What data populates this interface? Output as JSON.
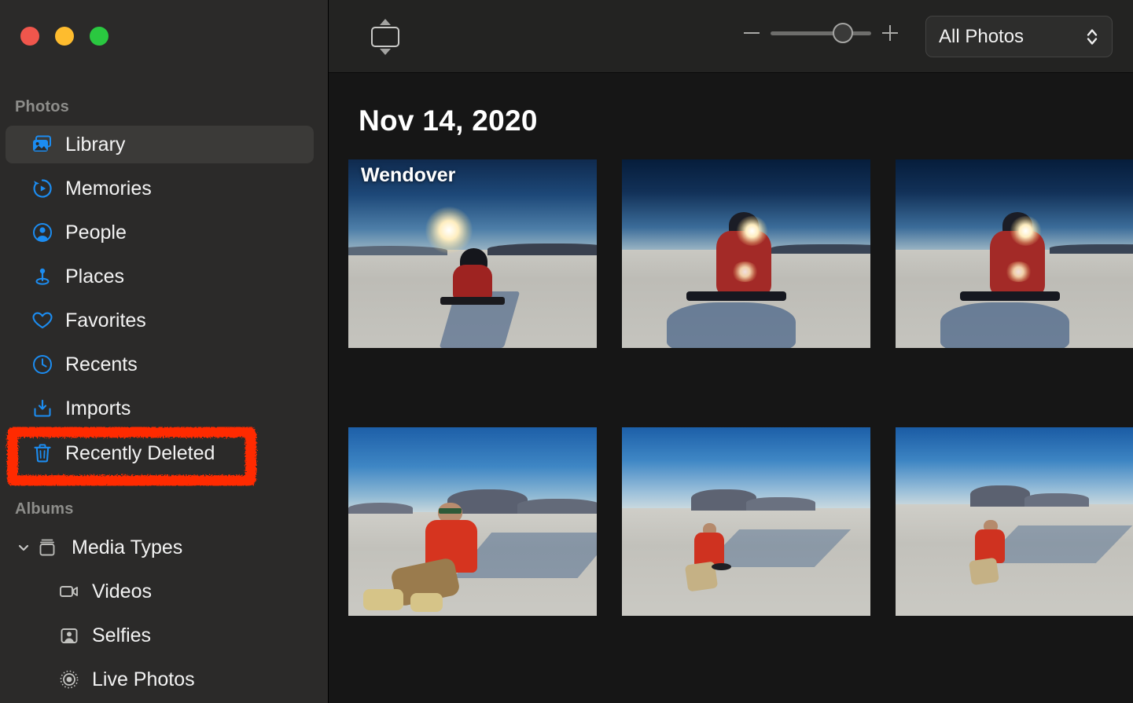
{
  "window": {
    "traffic_lights": [
      {
        "name": "close",
        "color": "#f0564c"
      },
      {
        "name": "minimize",
        "color": "#febc2e"
      },
      {
        "name": "maximize",
        "color": "#2ac840"
      }
    ]
  },
  "sidebar": {
    "sections": [
      {
        "header": "Photos",
        "items": [
          {
            "label": "Library",
            "icon": "photo-stack-icon",
            "selected": true,
            "highlighted": false
          },
          {
            "label": "Memories",
            "icon": "memories-icon",
            "selected": false,
            "highlighted": false
          },
          {
            "label": "People",
            "icon": "person-circle-icon",
            "selected": false,
            "highlighted": false
          },
          {
            "label": "Places",
            "icon": "map-pin-icon",
            "selected": false,
            "highlighted": false
          },
          {
            "label": "Favorites",
            "icon": "heart-icon",
            "selected": false,
            "highlighted": false
          },
          {
            "label": "Recents",
            "icon": "clock-icon",
            "selected": false,
            "highlighted": false
          },
          {
            "label": "Imports",
            "icon": "import-tray-icon",
            "selected": false,
            "highlighted": false
          },
          {
            "label": "Recently Deleted",
            "icon": "trash-icon",
            "selected": false,
            "highlighted": true
          }
        ]
      },
      {
        "header": "Albums",
        "items": [
          {
            "label": "Media Types",
            "icon": "album-box-icon",
            "group": true,
            "expanded": true
          },
          {
            "label": "Videos",
            "icon": "video-camera-icon",
            "group": false
          },
          {
            "label": "Selfies",
            "icon": "selfie-person-icon",
            "group": false
          },
          {
            "label": "Live Photos",
            "icon": "live-photo-icon",
            "group": false
          }
        ]
      }
    ]
  },
  "toolbar": {
    "view_button": "view-options-button",
    "zoom_out_label": "−",
    "zoom_in_label": "+",
    "zoom_value": 62,
    "filter_popup": {
      "value": "All Photos",
      "icon": "chevron-up-down-icon"
    }
  },
  "content": {
    "date_header": "Nov 14, 2020",
    "photos": [
      {
        "caption": "Wendover",
        "alt": "Person in red jacket sitting on a longboard on the Bonneville salt flats, facing away, sun overhead"
      },
      {
        "caption": "",
        "alt": "Close view of person in red jacket on longboard with sun flare behind their head"
      },
      {
        "caption": "",
        "alt": "Close view of person in red jacket on longboard with sun flare, salt flats horizon"
      },
      {
        "caption": "",
        "alt": "Man in red jacket and sunglasses sitting on salt flats facing camera, mountains behind"
      },
      {
        "caption": "",
        "alt": "Wide view of man in red jacket kneeling on salt flats with long shadow and mountain range"
      },
      {
        "caption": "",
        "alt": "Wide view of man in red jacket on salt flats with long shadow, mountains in distance"
      }
    ]
  },
  "annotation": {
    "type": "highlight-box",
    "target": "Recently Deleted",
    "color": "#ff2a00"
  },
  "colors": {
    "sidebar_bg": "#2b2a29",
    "content_bg": "#161616",
    "toolbar_bg": "#232322",
    "selected_row": "#3b3a38",
    "accent_blue": "#1c8cf0",
    "text_primary": "#f3f3f3",
    "text_secondary": "#8d8d8a"
  }
}
